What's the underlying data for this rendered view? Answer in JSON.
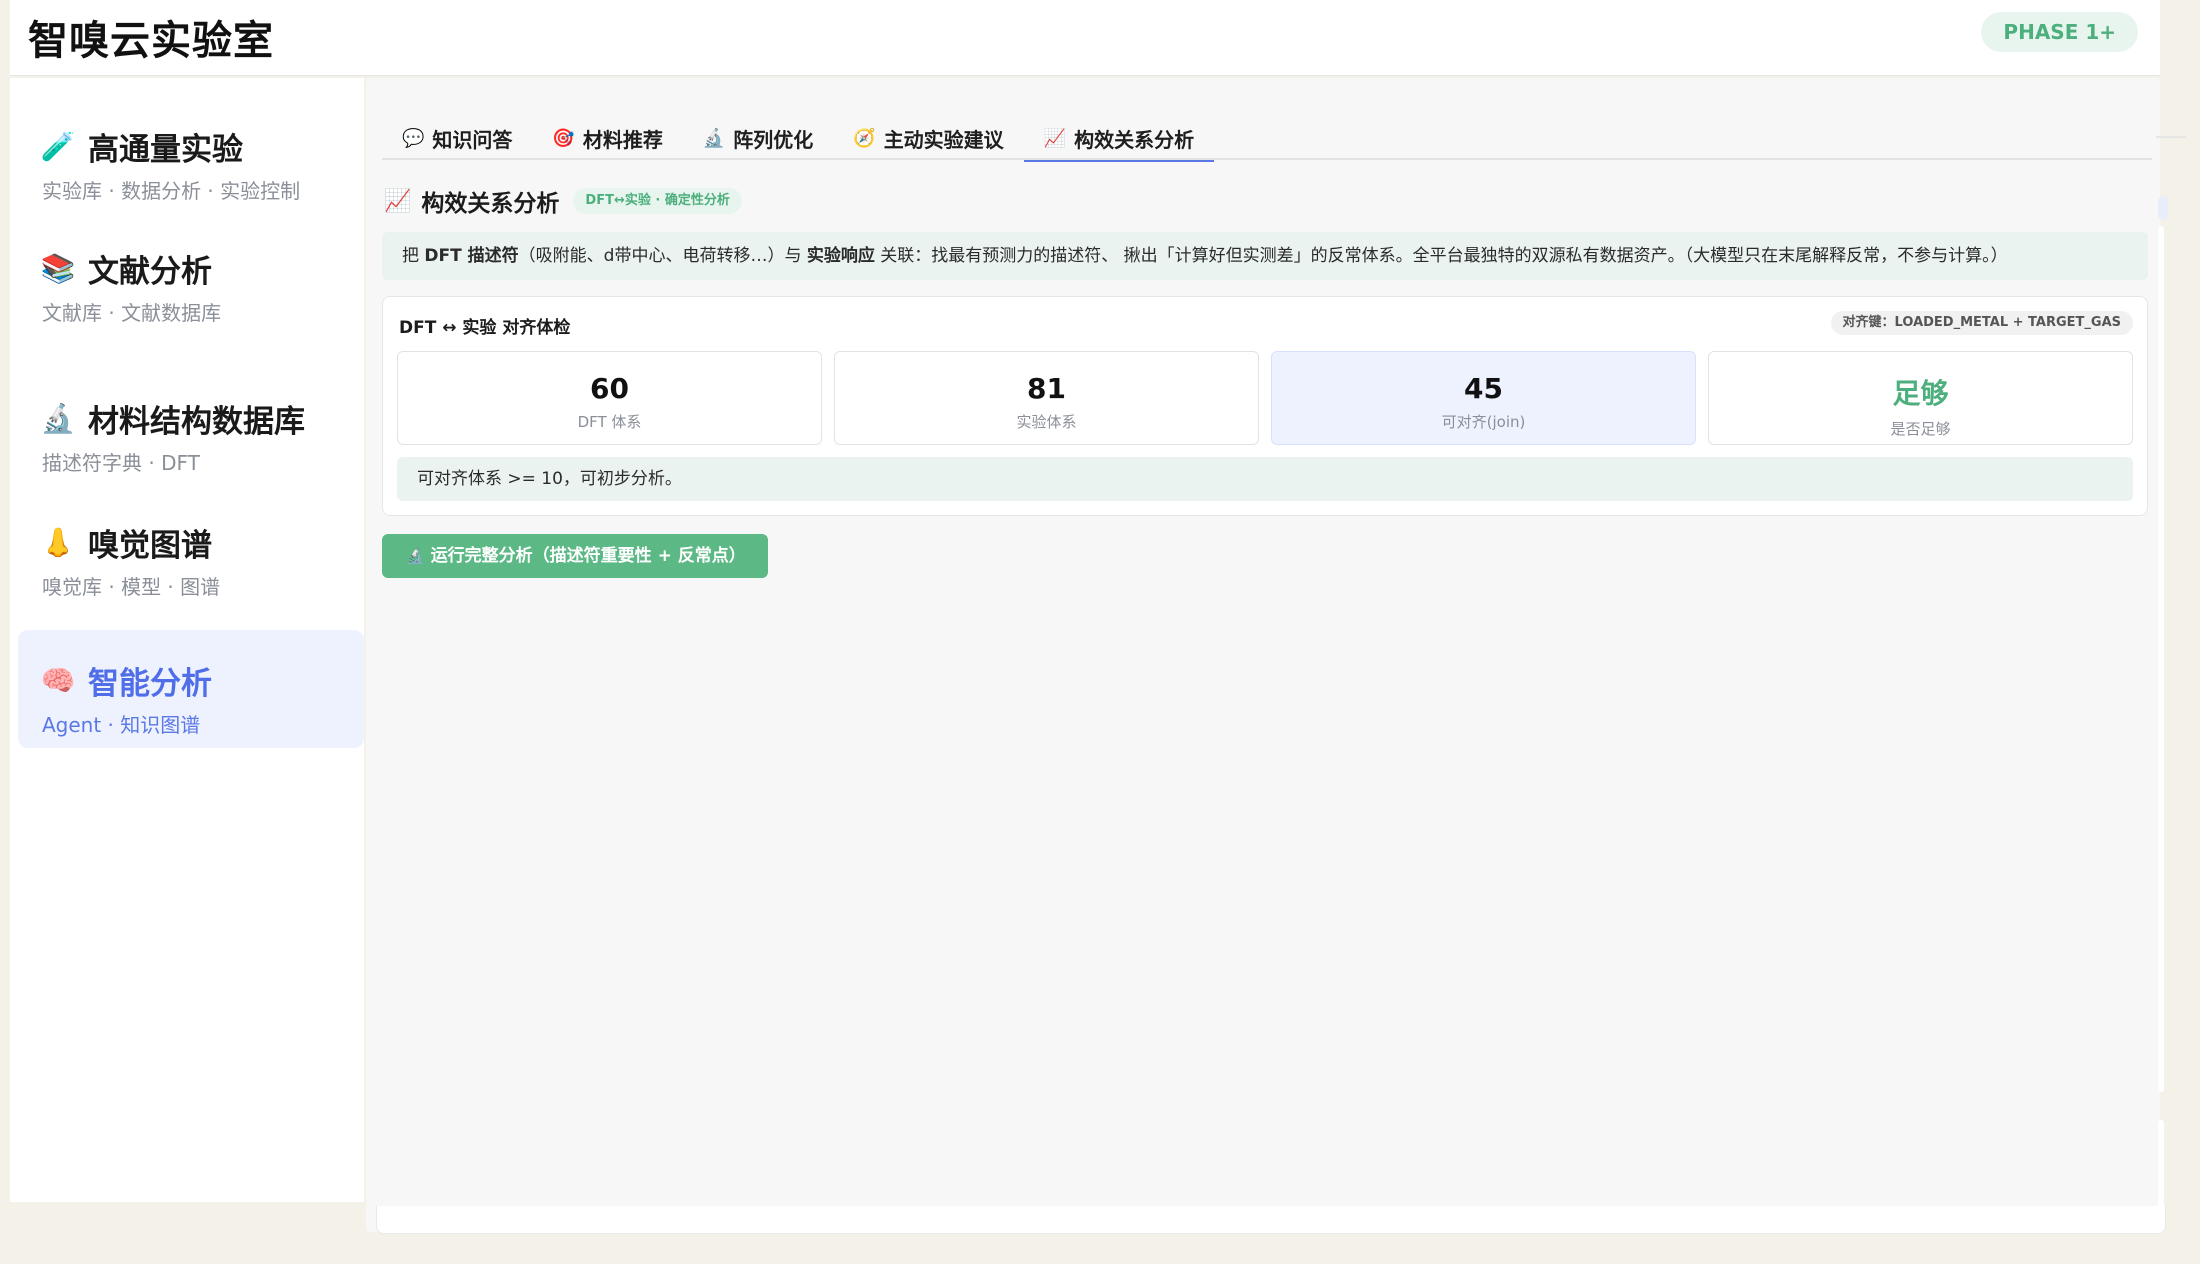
{
  "header": {
    "title": "智嗅云实验室",
    "phase_badge": "PHASE 1+"
  },
  "sidebar": {
    "items": [
      {
        "icon": "test-tube-icon",
        "glyph": "🧪",
        "label": "高通量实验",
        "sub": "实验库 · 数据分析 · 实验控制"
      },
      {
        "icon": "books-icon",
        "glyph": "📚",
        "label": "文献分析",
        "sub": "文献库 · 文献数据库"
      },
      {
        "icon": "microscope-icon",
        "glyph": "🔬",
        "label": "材料结构数据库",
        "sub": "描述符字典 · DFT"
      },
      {
        "icon": "nose-icon",
        "glyph": "👃",
        "label": "嗅觉图谱",
        "sub": "嗅觉库 · 模型 · 图谱"
      },
      {
        "icon": "brain-icon",
        "glyph": "🧠",
        "label": "智能分析",
        "sub": "Agent · 知识图谱"
      }
    ]
  },
  "tabs": [
    {
      "icon": "speech-bubble-icon",
      "glyph": "💬",
      "label": "知识问答"
    },
    {
      "icon": "target-icon",
      "glyph": "🎯",
      "label": "材料推荐"
    },
    {
      "icon": "microscope-icon",
      "glyph": "🔬",
      "label": "阵列优化"
    },
    {
      "icon": "compass-icon",
      "glyph": "🧭",
      "label": "主动实验建议"
    },
    {
      "icon": "chart-icon",
      "glyph": "📈",
      "label": "构效关系分析"
    }
  ],
  "section": {
    "glyph": "📈",
    "title": "构效关系分析",
    "tag": "DFT↔实验 · 确定性分析"
  },
  "description": {
    "p1": "把 ",
    "b1": "DFT 描述符",
    "p2": "（吸附能、d带中心、电荷转移…）与 ",
    "b2": "实验响应",
    "p3": " 关联：找最有预测力的描述符、 揪出「计算好但实测差」的反常体系。全平台最独特的双源私有数据资产。（大模型只在末尾解释反常，不参与计算。）"
  },
  "alignment": {
    "title": "DFT ↔ 实验 对齐体检",
    "key": "对齐键：LOADED_METAL + TARGET_GAS",
    "stats": [
      {
        "value": "60",
        "label": "DFT 体系"
      },
      {
        "value": "81",
        "label": "实验体系"
      },
      {
        "value": "45",
        "label": "可对齐(join)"
      },
      {
        "value": "足够",
        "label": "是否足够"
      }
    ],
    "note": "可对齐体系 >= 10，可初步分析。"
  },
  "run_button": {
    "glyph": "🔬",
    "label": "运行完整分析（描述符重要性 + 反常点）"
  },
  "colors": {
    "accent": "#4f6ee8",
    "green": "#4caf7d",
    "button": "#5cb885"
  }
}
